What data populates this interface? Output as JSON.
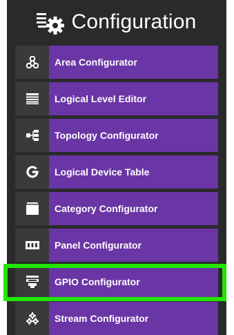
{
  "header": {
    "title": "Configuration",
    "icon": "configuration-gears-icon"
  },
  "menu": {
    "items": [
      {
        "label": "Area Configurator",
        "icon": "area-nodes-icon"
      },
      {
        "label": "Logical Level Editor",
        "icon": "layers-icon"
      },
      {
        "label": "Topology Configurator",
        "icon": "topology-tree-icon"
      },
      {
        "label": "Logical Device Table",
        "icon": "device-g-icon"
      },
      {
        "label": "Category Configurator",
        "icon": "category-stack-icon"
      },
      {
        "label": "Panel Configurator",
        "icon": "panel-keys-icon"
      },
      {
        "label": "GPIO Configurator",
        "icon": "gpio-chip-icon"
      },
      {
        "label": "Stream Configurator",
        "icon": "stream-gears-icon"
      }
    ]
  },
  "colors": {
    "panel": "#2a2a2a",
    "accent": "#6a35a5",
    "highlight": "#22e600"
  }
}
